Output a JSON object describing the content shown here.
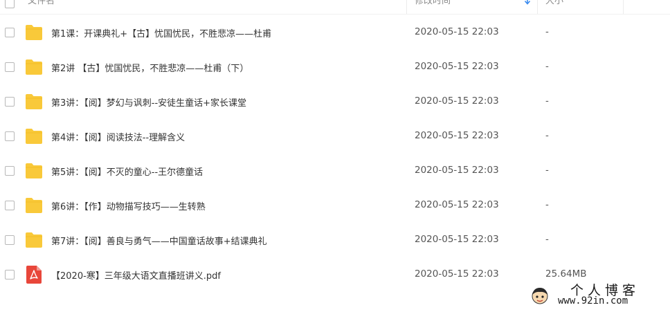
{
  "header": {
    "name_label": "文件名",
    "modified_label": "修改时间",
    "size_label": "大小"
  },
  "rows": [
    {
      "type": "folder",
      "name": "第1课：开课典礼+【古】忧国忧民，不胜悲凉——杜甫",
      "modified": "2020-05-15 22:03",
      "size": "-"
    },
    {
      "type": "folder",
      "name": "第2讲 【古】忧国忧民，不胜悲凉——杜甫（下）",
      "modified": "2020-05-15 22:03",
      "size": "-"
    },
    {
      "type": "folder",
      "name": "第3讲：【阅】梦幻与讽刺--安徒生童话+家长课堂",
      "modified": "2020-05-15 22:03",
      "size": "-"
    },
    {
      "type": "folder",
      "name": "第4讲：【阅】阅读技法--理解含义",
      "modified": "2020-05-15 22:03",
      "size": "-"
    },
    {
      "type": "folder",
      "name": "第5讲：【阅】不灭的童心--王尔德童话",
      "modified": "2020-05-15 22:03",
      "size": "-"
    },
    {
      "type": "folder",
      "name": "第6讲：【作】动物描写技巧——生转熟",
      "modified": "2020-05-15 22:03",
      "size": "-"
    },
    {
      "type": "folder",
      "name": "第7讲：【阅】善良与勇气——中国童话故事+结课典礼",
      "modified": "2020-05-15 22:03",
      "size": "-"
    },
    {
      "type": "pdf",
      "name": "【2020-寒】三年级大语文直播班讲义.pdf",
      "modified": "2020-05-15 22:03",
      "size": "25.64MB"
    }
  ],
  "watermark": {
    "title": "个人博客",
    "url": "www.92in.com"
  },
  "colors": {
    "folder": "#f9c93a",
    "pdf": "#e8463a",
    "sort_arrow": "#3b8cf0"
  }
}
